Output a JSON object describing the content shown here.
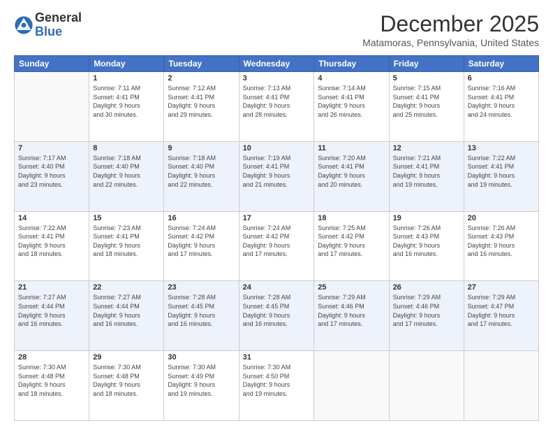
{
  "header": {
    "logo_general": "General",
    "logo_blue": "Blue",
    "month_title": "December 2025",
    "location": "Matamoras, Pennsylvania, United States"
  },
  "days_of_week": [
    "Sunday",
    "Monday",
    "Tuesday",
    "Wednesday",
    "Thursday",
    "Friday",
    "Saturday"
  ],
  "weeks": [
    [
      {
        "day": "",
        "info": ""
      },
      {
        "day": "1",
        "info": "Sunrise: 7:11 AM\nSunset: 4:41 PM\nDaylight: 9 hours\nand 30 minutes."
      },
      {
        "day": "2",
        "info": "Sunrise: 7:12 AM\nSunset: 4:41 PM\nDaylight: 9 hours\nand 29 minutes."
      },
      {
        "day": "3",
        "info": "Sunrise: 7:13 AM\nSunset: 4:41 PM\nDaylight: 9 hours\nand 28 minutes."
      },
      {
        "day": "4",
        "info": "Sunrise: 7:14 AM\nSunset: 4:41 PM\nDaylight: 9 hours\nand 26 minutes."
      },
      {
        "day": "5",
        "info": "Sunrise: 7:15 AM\nSunset: 4:41 PM\nDaylight: 9 hours\nand 25 minutes."
      },
      {
        "day": "6",
        "info": "Sunrise: 7:16 AM\nSunset: 4:41 PM\nDaylight: 9 hours\nand 24 minutes."
      }
    ],
    [
      {
        "day": "7",
        "info": "Sunrise: 7:17 AM\nSunset: 4:40 PM\nDaylight: 9 hours\nand 23 minutes."
      },
      {
        "day": "8",
        "info": "Sunrise: 7:18 AM\nSunset: 4:40 PM\nDaylight: 9 hours\nand 22 minutes."
      },
      {
        "day": "9",
        "info": "Sunrise: 7:18 AM\nSunset: 4:40 PM\nDaylight: 9 hours\nand 22 minutes."
      },
      {
        "day": "10",
        "info": "Sunrise: 7:19 AM\nSunset: 4:41 PM\nDaylight: 9 hours\nand 21 minutes."
      },
      {
        "day": "11",
        "info": "Sunrise: 7:20 AM\nSunset: 4:41 PM\nDaylight: 9 hours\nand 20 minutes."
      },
      {
        "day": "12",
        "info": "Sunrise: 7:21 AM\nSunset: 4:41 PM\nDaylight: 9 hours\nand 19 minutes."
      },
      {
        "day": "13",
        "info": "Sunrise: 7:22 AM\nSunset: 4:41 PM\nDaylight: 9 hours\nand 19 minutes."
      }
    ],
    [
      {
        "day": "14",
        "info": "Sunrise: 7:22 AM\nSunset: 4:41 PM\nDaylight: 9 hours\nand 18 minutes."
      },
      {
        "day": "15",
        "info": "Sunrise: 7:23 AM\nSunset: 4:41 PM\nDaylight: 9 hours\nand 18 minutes."
      },
      {
        "day": "16",
        "info": "Sunrise: 7:24 AM\nSunset: 4:42 PM\nDaylight: 9 hours\nand 17 minutes."
      },
      {
        "day": "17",
        "info": "Sunrise: 7:24 AM\nSunset: 4:42 PM\nDaylight: 9 hours\nand 17 minutes."
      },
      {
        "day": "18",
        "info": "Sunrise: 7:25 AM\nSunset: 4:42 PM\nDaylight: 9 hours\nand 17 minutes."
      },
      {
        "day": "19",
        "info": "Sunrise: 7:26 AM\nSunset: 4:43 PM\nDaylight: 9 hours\nand 16 minutes."
      },
      {
        "day": "20",
        "info": "Sunrise: 7:26 AM\nSunset: 4:43 PM\nDaylight: 9 hours\nand 16 minutes."
      }
    ],
    [
      {
        "day": "21",
        "info": "Sunrise: 7:27 AM\nSunset: 4:44 PM\nDaylight: 9 hours\nand 16 minutes."
      },
      {
        "day": "22",
        "info": "Sunrise: 7:27 AM\nSunset: 4:44 PM\nDaylight: 9 hours\nand 16 minutes."
      },
      {
        "day": "23",
        "info": "Sunrise: 7:28 AM\nSunset: 4:45 PM\nDaylight: 9 hours\nand 16 minutes."
      },
      {
        "day": "24",
        "info": "Sunrise: 7:28 AM\nSunset: 4:45 PM\nDaylight: 9 hours\nand 16 minutes."
      },
      {
        "day": "25",
        "info": "Sunrise: 7:29 AM\nSunset: 4:46 PM\nDaylight: 9 hours\nand 17 minutes."
      },
      {
        "day": "26",
        "info": "Sunrise: 7:29 AM\nSunset: 4:46 PM\nDaylight: 9 hours\nand 17 minutes."
      },
      {
        "day": "27",
        "info": "Sunrise: 7:29 AM\nSunset: 4:47 PM\nDaylight: 9 hours\nand 17 minutes."
      }
    ],
    [
      {
        "day": "28",
        "info": "Sunrise: 7:30 AM\nSunset: 4:48 PM\nDaylight: 9 hours\nand 18 minutes."
      },
      {
        "day": "29",
        "info": "Sunrise: 7:30 AM\nSunset: 4:48 PM\nDaylight: 9 hours\nand 18 minutes."
      },
      {
        "day": "30",
        "info": "Sunrise: 7:30 AM\nSunset: 4:49 PM\nDaylight: 9 hours\nand 19 minutes."
      },
      {
        "day": "31",
        "info": "Sunrise: 7:30 AM\nSunset: 4:50 PM\nDaylight: 9 hours\nand 19 minutes."
      },
      {
        "day": "",
        "info": ""
      },
      {
        "day": "",
        "info": ""
      },
      {
        "day": "",
        "info": ""
      }
    ]
  ]
}
